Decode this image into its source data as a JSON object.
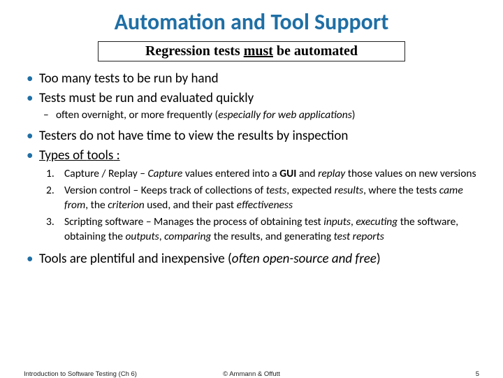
{
  "title": "Automation and Tool Support",
  "subtitle_pre": "Regression tests ",
  "subtitle_emp": "must",
  "subtitle_post": " be automated",
  "b1": "Too many tests to be run by hand",
  "b2": "Tests must be run and evaluated quickly",
  "b2_sub_a": "often overnight, or more frequently (",
  "b2_sub_b": "especially for web applications",
  "b2_sub_c": ")",
  "b3": "Testers do not have time to view the results by inspection",
  "b4_a": "Types of ",
  "b4_b": "tools",
  "b4_c": " :",
  "t1_n": "1.",
  "t1_a": "Capture / Replay – ",
  "t1_b": "Capture",
  "t1_c": " values entered into a ",
  "t1_d": "GUI",
  "t1_e": " and ",
  "t1_f": "replay",
  "t1_g": " those values on new versions",
  "t2_n": "2.",
  "t2_a": "Version control – Keeps track of collections of ",
  "t2_b": "tests",
  "t2_c": ", expected ",
  "t2_d": "results",
  "t2_e": ", where the tests ",
  "t2_f": "came from",
  "t2_g": ", the ",
  "t2_h": "criterion",
  "t2_i": " used, and their past ",
  "t2_j": "effectiveness",
  "t3_n": "3.",
  "t3_a": "Scripting software – Manages the process of obtaining test ",
  "t3_b": "inputs",
  "t3_c": ", ",
  "t3_d": "executing",
  "t3_e": " the software, obtaining the ",
  "t3_f": "outputs",
  "t3_g": ", ",
  "t3_h": "comparing",
  "t3_i": " the results, and generating ",
  "t3_j": "test reports",
  "b5_a": "Tools are plentiful and inexpensive (",
  "b5_b": "often open-source and free",
  "b5_c": ")",
  "footer_left": "Introduction to Software Testing (Ch 6)",
  "footer_center": "© Ammann & Offutt",
  "footer_right": "5"
}
